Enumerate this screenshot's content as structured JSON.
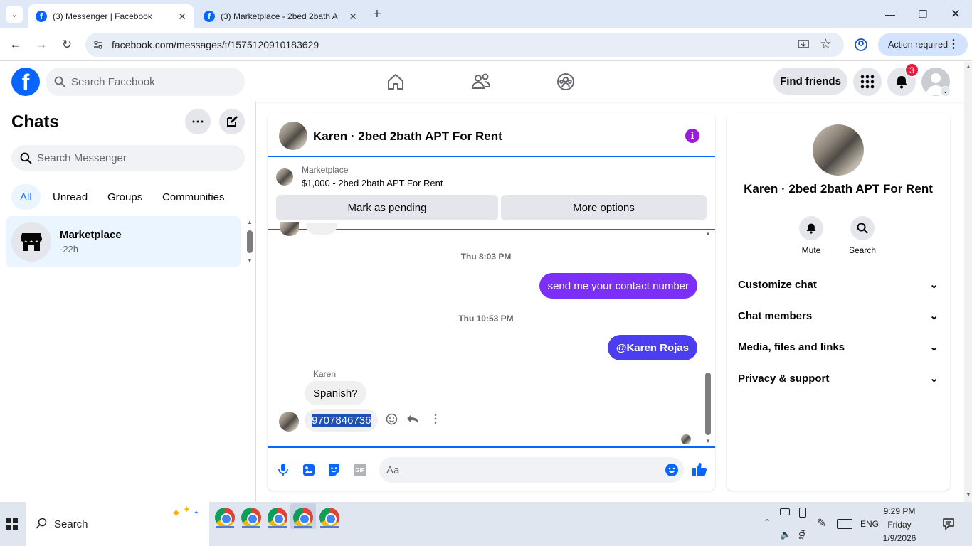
{
  "browser": {
    "tabs": [
      {
        "title": "(3) Messenger | Facebook",
        "active": true
      },
      {
        "title": "(3) Marketplace - 2bed 2bath A",
        "active": false
      }
    ],
    "url": "facebook.com/messages/t/1575120910183629",
    "action_required": "Action required"
  },
  "header": {
    "logo": "f",
    "search_placeholder": "Search Facebook",
    "find_friends": "Find friends",
    "notification_count": "3"
  },
  "chats": {
    "title": "Chats",
    "search_placeholder": "Search Messenger",
    "filters": [
      "All",
      "Unread",
      "Groups",
      "Communities"
    ],
    "items": [
      {
        "name": "Marketplace",
        "time": "·22h"
      }
    ]
  },
  "conversation": {
    "title": "Karen · 2bed 2bath APT For Rent",
    "marketplace_label": "Marketplace",
    "listing": "$1,000 - 2bed 2bath APT For Rent",
    "mark_pending": "Mark as pending",
    "more_options": "More options",
    "messages": [
      {
        "type": "timestamp",
        "text": "Thu 8:03 PM"
      },
      {
        "type": "outgoing",
        "text": "send me your contact number"
      },
      {
        "type": "timestamp",
        "text": "Thu 10:53 PM"
      },
      {
        "type": "outgoing",
        "text": "@Karen Rojas"
      },
      {
        "type": "sender",
        "text": "Karen"
      },
      {
        "type": "incoming",
        "text": "Spanish?"
      },
      {
        "type": "incoming",
        "text": "9707846736"
      }
    ],
    "composer_placeholder": "Aa"
  },
  "info": {
    "name": "Karen · 2bed 2bath APT For Rent",
    "mute": "Mute",
    "search": "Search",
    "sections": [
      "Customize chat",
      "Chat members",
      "Media, files and links",
      "Privacy & support"
    ]
  },
  "taskbar": {
    "search": "Search",
    "lang": "ENG",
    "time": "9:29 PM",
    "day": "Friday",
    "date": "1/9/2026"
  },
  "colors": {
    "fb_blue": "#0866ff",
    "bubble_purple": "#7b2ff7",
    "bubble_indigo": "#4a3ef0",
    "badge_red": "#e41e3f"
  }
}
